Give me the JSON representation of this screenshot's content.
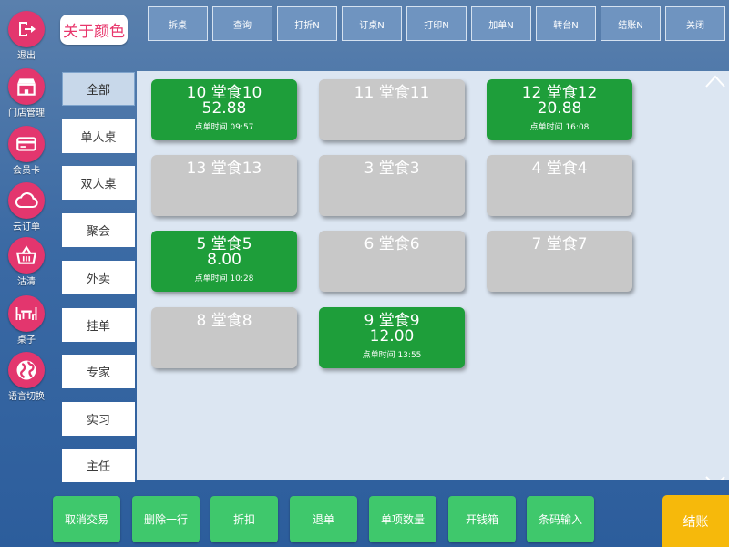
{
  "sidebar": {
    "items": [
      {
        "label": "退出",
        "icon": "logout-icon"
      },
      {
        "label": "门店管理",
        "icon": "store-icon"
      },
      {
        "label": "会员卡",
        "icon": "member-card-icon"
      },
      {
        "label": "云订单",
        "icon": "cloud-icon"
      },
      {
        "label": "沽清",
        "icon": "basket-icon"
      },
      {
        "label": "桌子",
        "icon": "table-icon"
      },
      {
        "label": "语言切换",
        "icon": "globe-icon"
      }
    ]
  },
  "about_button": "关于颜色",
  "top_toolbar": [
    "拆桌",
    "查询",
    "打折N",
    "订桌N",
    "打印N",
    "加单N",
    "转台N",
    "结账N",
    "关闭"
  ],
  "categories": [
    "全部",
    "单人桌",
    "双人桌",
    "聚会",
    "外卖",
    "挂单",
    "专家",
    "实习",
    "主任"
  ],
  "tables": [
    {
      "name": "10 堂食10",
      "amount": "52.88",
      "time": "点单时间 09:57",
      "busy": true
    },
    {
      "name": "11 堂食11",
      "amount": "",
      "time": "",
      "busy": false
    },
    {
      "name": "12 堂食12",
      "amount": "20.88",
      "time": "点单时间 16:08",
      "busy": true
    },
    {
      "name": "13 堂食13",
      "amount": "",
      "time": "",
      "busy": false
    },
    {
      "name": "3 堂食3",
      "amount": "",
      "time": "",
      "busy": false
    },
    {
      "name": "4 堂食4",
      "amount": "",
      "time": "",
      "busy": false
    },
    {
      "name": "5 堂食5",
      "amount": "8.00",
      "time": "点单时间 10:28",
      "busy": true
    },
    {
      "name": "6 堂食6",
      "amount": "",
      "time": "",
      "busy": false
    },
    {
      "name": "7 堂食7",
      "amount": "",
      "time": "",
      "busy": false
    },
    {
      "name": "8 堂食8",
      "amount": "",
      "time": "",
      "busy": false
    },
    {
      "name": "9 堂食9",
      "amount": "12.00",
      "time": "点单时间 13:55",
      "busy": true
    }
  ],
  "bottom_toolbar": [
    "取消交易",
    "删除一行",
    "折扣",
    "退单",
    "单项数量",
    "开钱箱",
    "条码输入"
  ],
  "checkout_button": "结账",
  "colors": {
    "occupied": "#1e9e3a",
    "free": "#c8c8c8",
    "sidebar_icon": "#e3366e",
    "checkout": "#f6b90b",
    "action": "#3fc86c"
  }
}
